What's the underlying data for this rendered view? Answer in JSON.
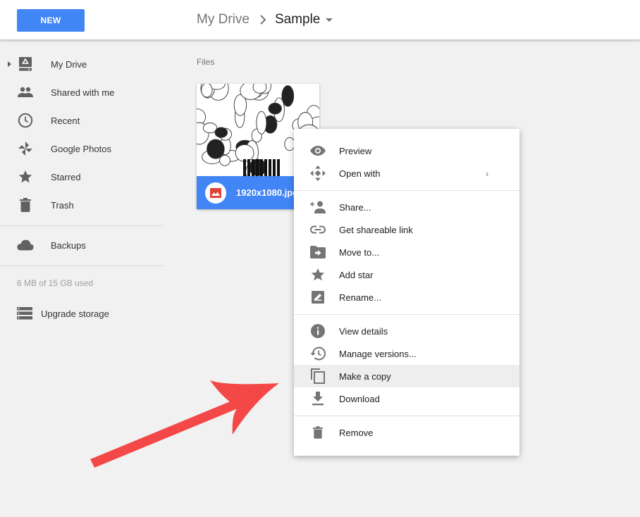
{
  "header": {
    "new_button": "NEW",
    "breadcrumb": {
      "root": "My Drive",
      "separator_icon": "chevron-right-icon",
      "current": "Sample",
      "dropdown_icon": "caret-down-icon"
    }
  },
  "sidebar": {
    "items": [
      {
        "label": "My Drive",
        "icon": "drive-icon",
        "expandable": true
      },
      {
        "label": "Shared with me",
        "icon": "people-icon"
      },
      {
        "label": "Recent",
        "icon": "clock-icon"
      },
      {
        "label": "Google Photos",
        "icon": "photos-pinwheel-icon"
      },
      {
        "label": "Starred",
        "icon": "star-icon"
      },
      {
        "label": "Trash",
        "icon": "trash-icon"
      }
    ],
    "backups": {
      "label": "Backups",
      "icon": "cloud-icon"
    },
    "storage": {
      "used_text": "6 MB of 15 GB used"
    },
    "upgrade": {
      "label": "Upgrade storage",
      "icon": "storage-icon"
    }
  },
  "main": {
    "section_label": "Files",
    "files": [
      {
        "name": "1920x1080.jpg",
        "type_icon": "image-file-icon",
        "selected": true
      }
    ]
  },
  "context_menu": {
    "groups": [
      [
        {
          "label": "Preview",
          "icon": "eye-icon"
        },
        {
          "label": "Open with",
          "icon": "open-with-icon",
          "submenu": true,
          "submenu_glyph": "›"
        }
      ],
      [
        {
          "label": "Share...",
          "icon": "add-person-icon"
        },
        {
          "label": "Get shareable link",
          "icon": "link-icon"
        },
        {
          "label": "Move to...",
          "icon": "move-folder-icon"
        },
        {
          "label": "Add star",
          "icon": "star-icon"
        },
        {
          "label": "Rename...",
          "icon": "rename-icon"
        }
      ],
      [
        {
          "label": "View details",
          "icon": "info-icon"
        },
        {
          "label": "Manage versions...",
          "icon": "history-icon"
        },
        {
          "label": "Make a copy",
          "icon": "copy-icon",
          "highlighted": true
        },
        {
          "label": "Download",
          "icon": "download-icon"
        }
      ],
      [
        {
          "label": "Remove",
          "icon": "trash-icon"
        }
      ]
    ]
  },
  "annotation": {
    "type": "arrow",
    "points_to": "Make a copy",
    "color": "#f44848"
  },
  "colors": {
    "accent": "#4285f4",
    "background": "#f1f1f1",
    "icon_gray": "#757575",
    "menu_hover": "#eeeeee",
    "file_icon_red": "#db4437"
  }
}
